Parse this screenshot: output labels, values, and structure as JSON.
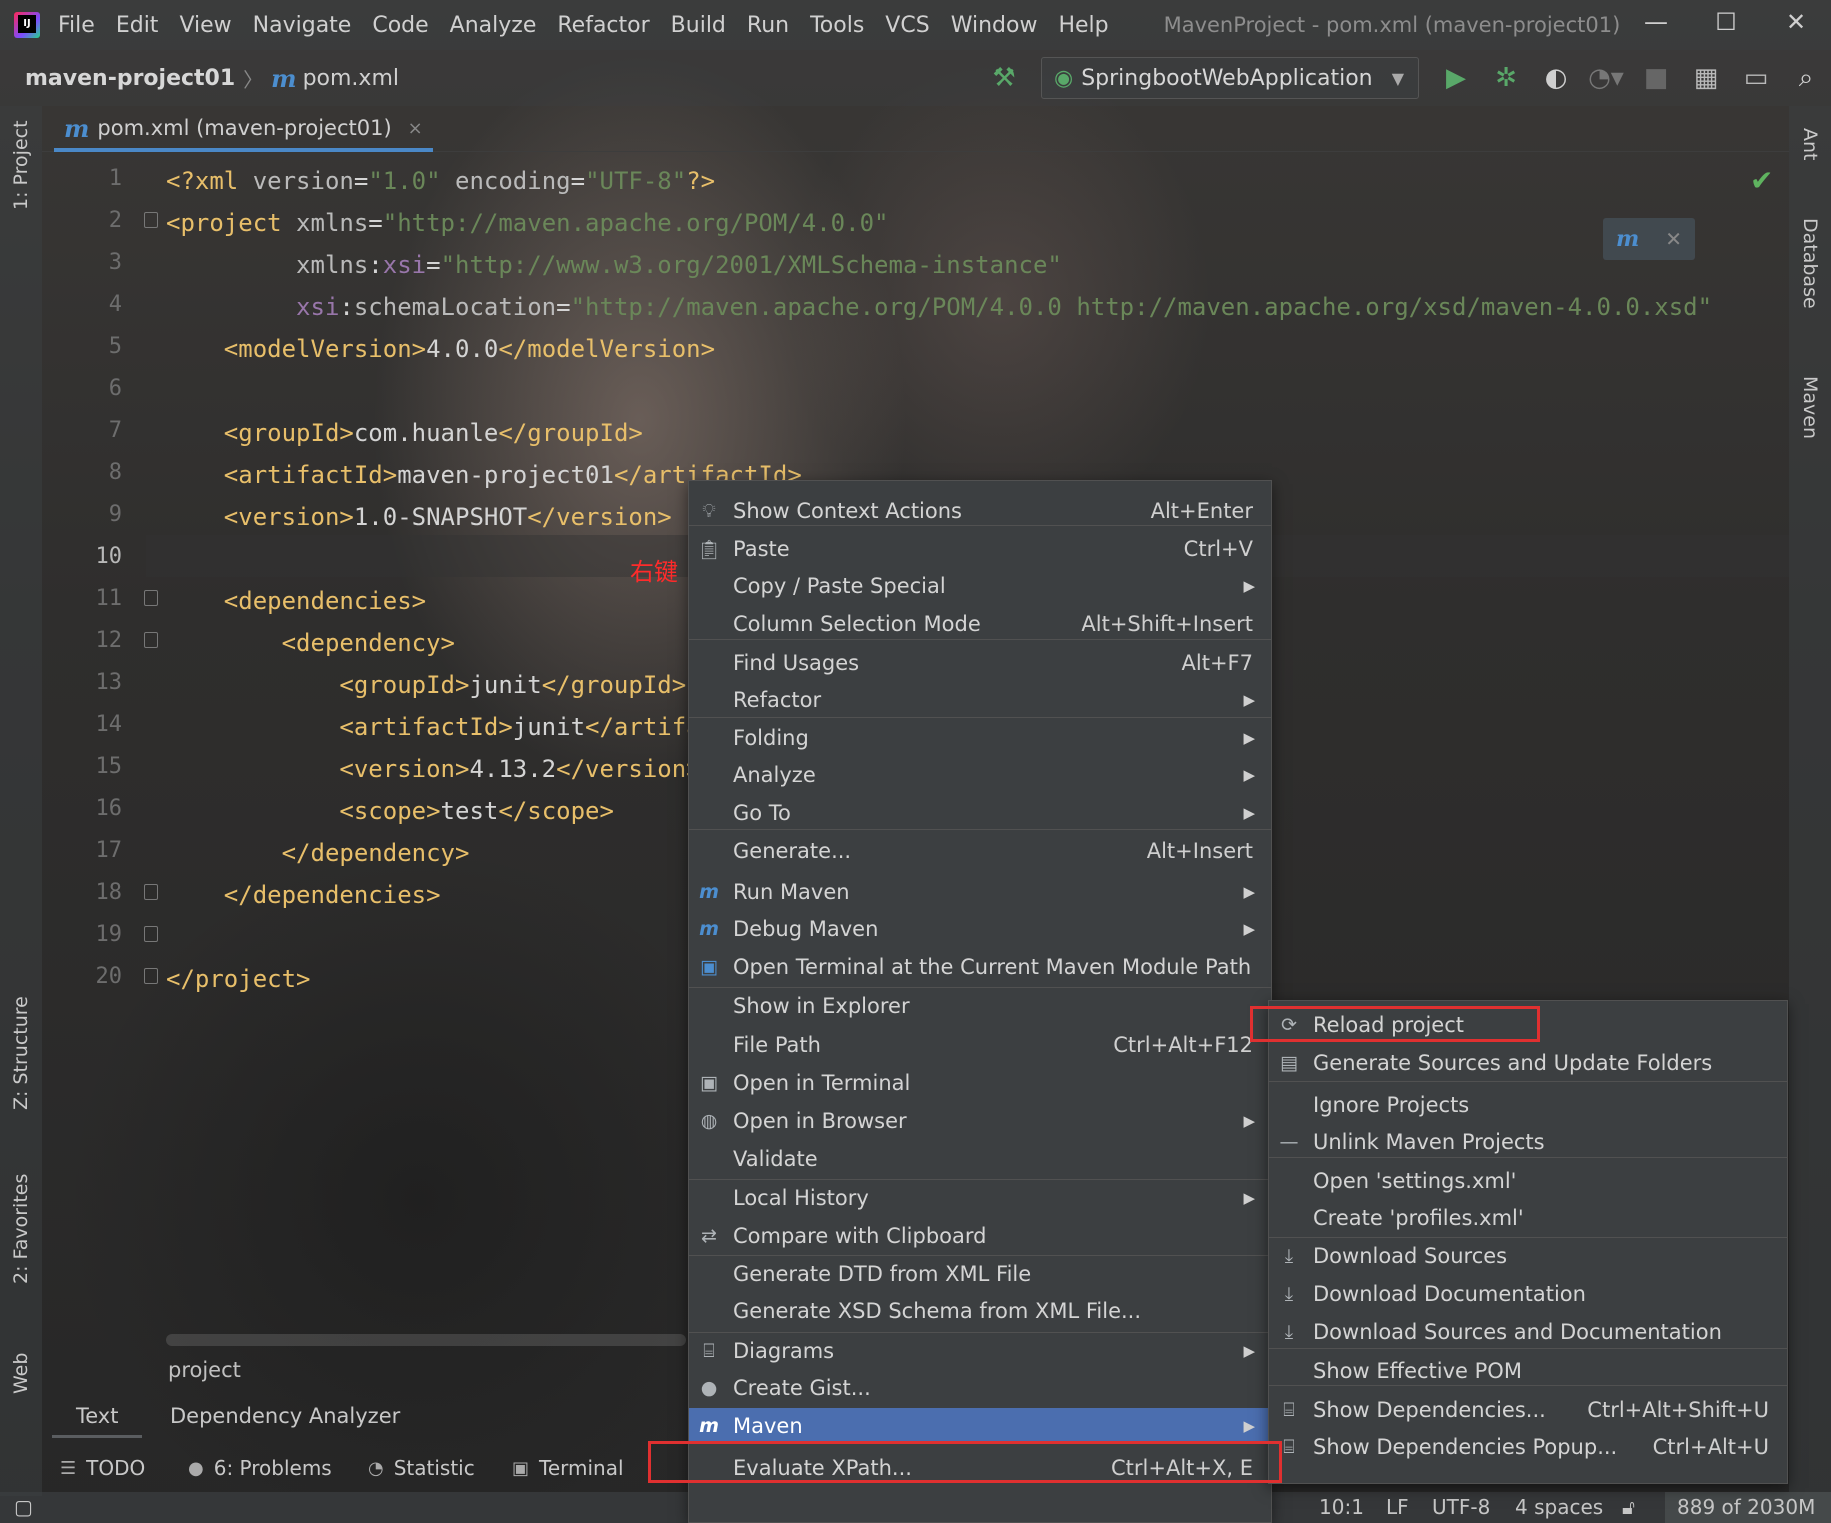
{
  "window": {
    "title": "MavenProject - pom.xml (maven-project01)",
    "menu": [
      "File",
      "Edit",
      "View",
      "Navigate",
      "Code",
      "Analyze",
      "Refactor",
      "Build",
      "Run",
      "Tools",
      "VCS",
      "Window",
      "Help"
    ],
    "controls": {
      "minimize": "—",
      "maximize": "☐",
      "close": "✕"
    }
  },
  "navbar": {
    "project": "maven-project01",
    "file": "pom.xml",
    "run_config": "SpringbootWebApplication",
    "icons": [
      "build-hammer-icon",
      "run-icon",
      "debug-icon",
      "coverage-icon",
      "profile-icon",
      "stop-icon",
      "project-structure-icon",
      "presentation-icon",
      "search-icon"
    ]
  },
  "editor_tab": {
    "label": "pom.xml (maven-project01)",
    "close": "×"
  },
  "side_tabs": {
    "left": [
      "1: Project",
      "Z: Structure",
      "2: Favorites",
      "Web"
    ],
    "right": [
      "Ant",
      "Database",
      "Maven"
    ]
  },
  "code": {
    "line_numbers": [
      "1",
      "2",
      "3",
      "4",
      "5",
      "6",
      "7",
      "8",
      "9",
      "10",
      "11",
      "12",
      "13",
      "14",
      "15",
      "16",
      "17",
      "18",
      "19",
      "20"
    ],
    "active_line": "10",
    "annotation": "右键"
  },
  "bottom": {
    "breadcrumb": "project",
    "subtabs": [
      "Text",
      "Dependency Analyzer"
    ],
    "toolwindows": [
      "TODO",
      "6: Problems",
      "Statistic",
      "Terminal"
    ]
  },
  "status": {
    "position": "10:1",
    "line_sep": "LF",
    "encoding": "UTF-8",
    "indent": "4 spaces",
    "memory": "889 of 2030M"
  },
  "context_menu": [
    {
      "icon": "lightbulb-icon",
      "label": "Show Context Actions",
      "shortcut": "Alt+Enter"
    },
    {
      "icon": "paste-icon",
      "label": "Paste",
      "shortcut": "Ctrl+V"
    },
    {
      "label": "Copy / Paste Special",
      "submenu": true
    },
    {
      "label": "Column Selection Mode",
      "shortcut": "Alt+Shift+Insert"
    },
    {
      "label": "Find Usages",
      "shortcut": "Alt+F7"
    },
    {
      "label": "Refactor",
      "submenu": true
    },
    {
      "label": "Folding",
      "submenu": true
    },
    {
      "label": "Analyze",
      "submenu": true
    },
    {
      "label": "Go To",
      "submenu": true
    },
    {
      "label": "Generate...",
      "shortcut": "Alt+Insert"
    },
    {
      "icon": "run-maven-icon",
      "label": "Run Maven",
      "submenu": true
    },
    {
      "icon": "debug-maven-icon",
      "label": "Debug Maven",
      "submenu": true
    },
    {
      "icon": "terminal-maven-icon",
      "label": "Open Terminal at the Current Maven Module Path"
    },
    {
      "label": "Show in Explorer"
    },
    {
      "label": "File Path",
      "shortcut": "Ctrl+Alt+F12"
    },
    {
      "icon": "terminal-icon",
      "label": "Open in Terminal"
    },
    {
      "icon": "globe-icon",
      "label": "Open in Browser",
      "submenu": true
    },
    {
      "label": "Validate"
    },
    {
      "label": "Local History",
      "submenu": true
    },
    {
      "icon": "compare-icon",
      "label": "Compare with Clipboard"
    },
    {
      "label": "Generate DTD from XML File"
    },
    {
      "label": "Generate XSD Schema from XML File..."
    },
    {
      "icon": "diagram-icon",
      "label": "Diagrams",
      "submenu": true
    },
    {
      "icon": "github-icon",
      "label": "Create Gist..."
    },
    {
      "icon": "maven-icon",
      "label": "Maven",
      "submenu": true,
      "selected": true
    },
    {
      "label": "Evaluate XPath...",
      "shortcut": "Ctrl+Alt+X, E"
    }
  ],
  "maven_submenu": [
    {
      "icon": "reload-icon",
      "label": "Reload project"
    },
    {
      "icon": "generate-sources-icon",
      "label": "Generate Sources and Update Folders"
    },
    {
      "label": "Ignore Projects"
    },
    {
      "icon": "minus-icon",
      "label": "Unlink Maven Projects"
    },
    {
      "label": "Open 'settings.xml'"
    },
    {
      "label": "Create 'profiles.xml'"
    },
    {
      "icon": "download-icon",
      "label": "Download Sources"
    },
    {
      "icon": "download-icon",
      "label": "Download Documentation"
    },
    {
      "icon": "download-icon",
      "label": "Download Sources and Documentation"
    },
    {
      "label": "Show Effective POM"
    },
    {
      "icon": "dependencies-icon",
      "label": "Show Dependencies...",
      "shortcut": "Ctrl+Alt+Shift+U"
    },
    {
      "icon": "dependencies-icon",
      "label": "Show Dependencies Popup...",
      "shortcut": "Ctrl+Alt+U"
    }
  ]
}
